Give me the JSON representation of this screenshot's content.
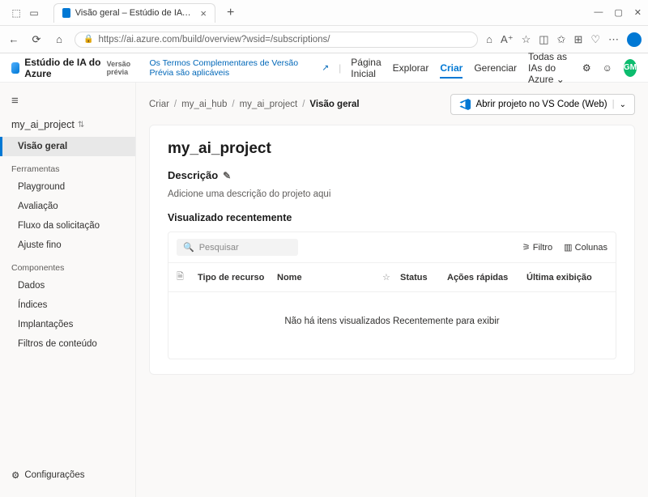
{
  "browser": {
    "tab_title": "Visão geral – Estúdio de IA do Azure",
    "url": "https://ai.azure.com/build/overview?wsid=/subscriptions/"
  },
  "header": {
    "brand": "Estúdio de IA do Azure",
    "preview": "Versão prévia",
    "terms_link": "Os Termos Complementares de Versão Prévia são aplicáveis",
    "nav": {
      "home": "Página Inicial",
      "explore": "Explorar",
      "create": "Criar",
      "manage": "Gerenciar",
      "all_ais": "Todas as IAs do Azure"
    },
    "avatar_initials": "GM"
  },
  "sidebar": {
    "project_name": "my_ai_project",
    "overview": "Visão geral",
    "tools_section": "Ferramentas",
    "tools": {
      "playground": "Playground",
      "evaluation": "Avaliação",
      "prompt_flow": "Fluxo da solicitação",
      "fine_tuning": "Ajuste fino"
    },
    "components_section": "Componentes",
    "components": {
      "data": "Dados",
      "indexes": "Índices",
      "deployments": "Implantações",
      "content_filters": "Filtros de conteúdo"
    },
    "settings": "Configurações"
  },
  "breadcrumbs": {
    "criar": "Criar",
    "hub": "my_ai_hub",
    "project": "my_ai_project",
    "current": "Visão geral"
  },
  "vscode_button": "Abrir projeto no VS Code (Web)",
  "card": {
    "title": "my_ai_project",
    "description_label": "Descrição",
    "description_placeholder": "Adicione uma descrição do projeto aqui",
    "recently_viewed": "Visualizado recentemente",
    "search_placeholder": "Pesquisar",
    "filter": "Filtro",
    "columns": "Colunas",
    "table_headers": {
      "resource_type": "Tipo de recurso",
      "name": "Nome",
      "status": "Status",
      "quick_actions": "Ações rápidas",
      "last_viewed": "Última exibição"
    },
    "empty_state": "Não há itens visualizados Recentemente para exibir"
  }
}
